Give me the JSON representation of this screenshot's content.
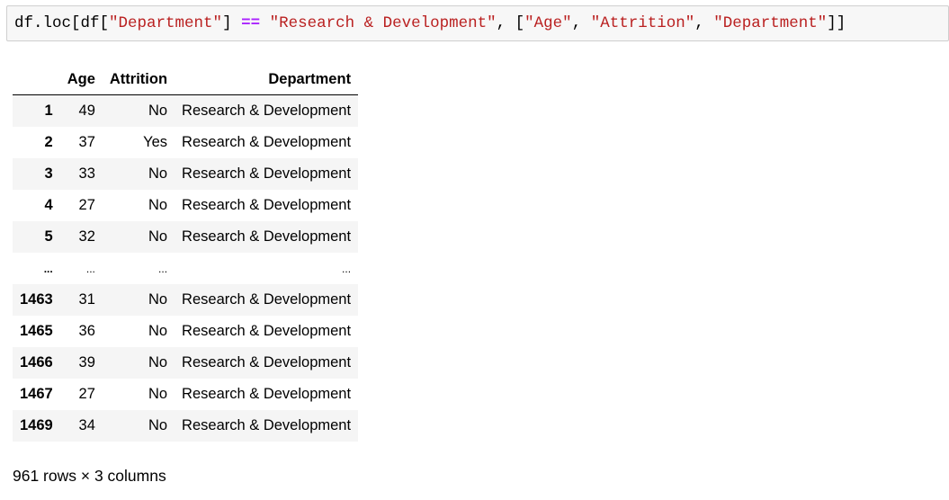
{
  "code_cell": {
    "tokens": [
      {
        "text": "df.loc[df[",
        "kind": "name"
      },
      {
        "text": "\"Department\"",
        "kind": "str"
      },
      {
        "text": "] ",
        "kind": "punc"
      },
      {
        "text": "==",
        "kind": "op"
      },
      {
        "text": " ",
        "kind": "punc"
      },
      {
        "text": "\"Research & Development\"",
        "kind": "str"
      },
      {
        "text": ", [",
        "kind": "punc"
      },
      {
        "text": "\"Age\"",
        "kind": "str"
      },
      {
        "text": ", ",
        "kind": "punc"
      },
      {
        "text": "\"Attrition\"",
        "kind": "str"
      },
      {
        "text": ", ",
        "kind": "punc"
      },
      {
        "text": "\"Department\"",
        "kind": "str"
      },
      {
        "text": "]]",
        "kind": "punc"
      }
    ]
  },
  "dataframe": {
    "index_header": "",
    "columns": [
      "Age",
      "Attrition",
      "Department"
    ],
    "rows": [
      {
        "index": "1",
        "cells": [
          "49",
          "No",
          "Research & Development"
        ]
      },
      {
        "index": "2",
        "cells": [
          "37",
          "Yes",
          "Research & Development"
        ]
      },
      {
        "index": "3",
        "cells": [
          "33",
          "No",
          "Research & Development"
        ]
      },
      {
        "index": "4",
        "cells": [
          "27",
          "No",
          "Research & Development"
        ]
      },
      {
        "index": "5",
        "cells": [
          "32",
          "No",
          "Research & Development"
        ]
      },
      {
        "index": "...",
        "cells": [
          "...",
          "...",
          "..."
        ],
        "ellipsis": true
      },
      {
        "index": "1463",
        "cells": [
          "31",
          "No",
          "Research & Development"
        ]
      },
      {
        "index": "1465",
        "cells": [
          "36",
          "No",
          "Research & Development"
        ]
      },
      {
        "index": "1466",
        "cells": [
          "39",
          "No",
          "Research & Development"
        ]
      },
      {
        "index": "1467",
        "cells": [
          "27",
          "No",
          "Research & Development"
        ]
      },
      {
        "index": "1469",
        "cells": [
          "34",
          "No",
          "Research & Development"
        ]
      }
    ]
  },
  "shape_info": "961 rows × 3 columns",
  "colors": {
    "string": "#ba2121",
    "operator": "#aa22ff",
    "cell_background": "#f7f7f7",
    "cell_border": "#cfcfcf",
    "stripe": "#f5f5f5"
  }
}
